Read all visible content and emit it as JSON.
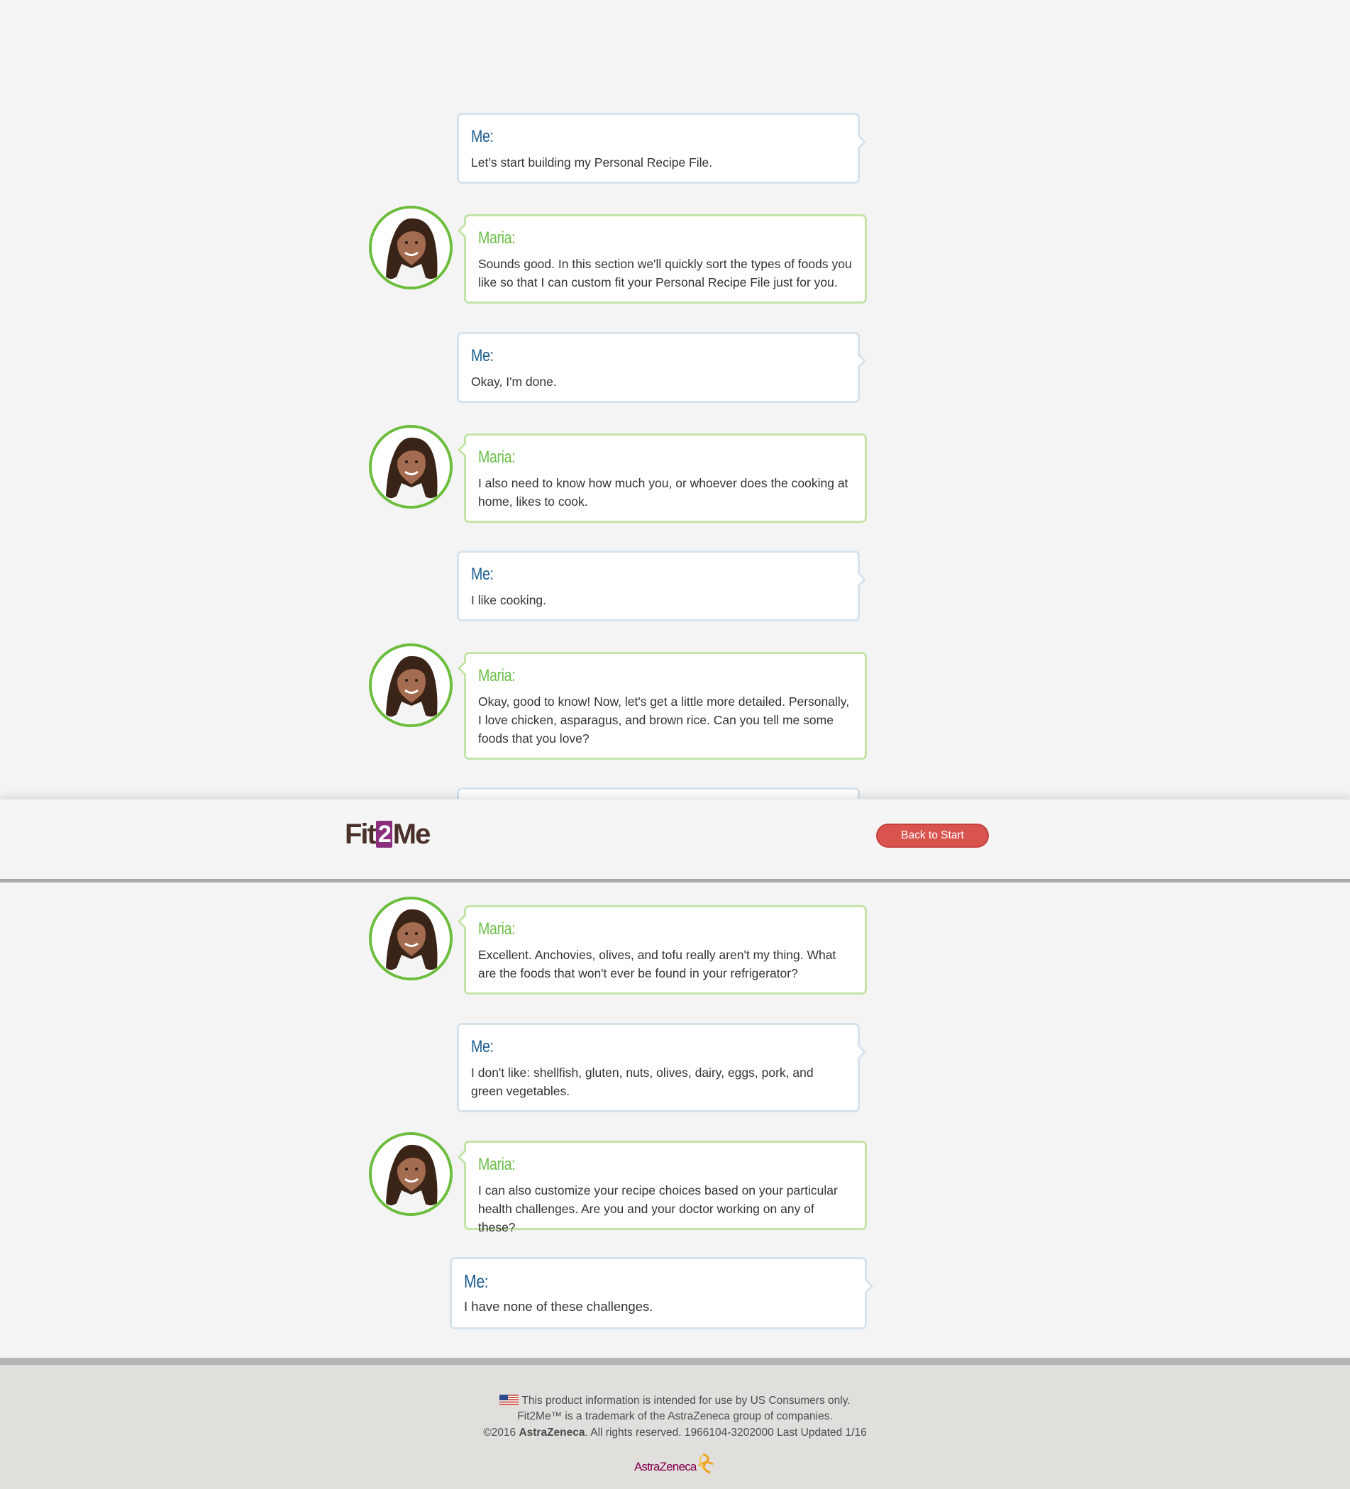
{
  "header": {
    "logo_text_a": "Fit",
    "logo_text_num": "2",
    "logo_text_b": "Me",
    "back_button_label": "Back to Start"
  },
  "conversation": {
    "me_name": "Me:",
    "maria_name": "Maria:",
    "messages": [
      {
        "speaker": "Me:",
        "text": "Let’s start building my Personal Recipe File."
      },
      {
        "speaker": "Maria:",
        "text": "Sounds good. In this section we'll quickly sort the types of foods you like so that I can custom fit your Personal Recipe File just for you."
      },
      {
        "speaker": "Me:",
        "text": "Okay, I'm done."
      },
      {
        "speaker": "Maria:",
        "text": "I also need to know how much you, or whoever does the cooking at home, likes to cook."
      },
      {
        "speaker": "Me:",
        "text": "I like cooking."
      },
      {
        "speaker": "Maria:",
        "text": "Okay, good to know! Now, let's get a little more detailed. Personally, I love chicken, asparagus, and brown rice. Can you tell me some foods that you love?"
      },
      {
        "speaker": "Maria:",
        "text": "Excellent. Anchovies, olives, and tofu really aren't my thing. What are the foods that won't ever be found in your refrigerator?"
      },
      {
        "speaker": "Me:",
        "text": "I don't like: shellfish, gluten, nuts, olives, dairy, eggs, pork, and green vegetables."
      },
      {
        "speaker": "Maria:",
        "text": "I can also customize your recipe choices based on your particular health challenges. Are you and your doctor working on any of these?"
      },
      {
        "speaker": "Me:",
        "text": "I have none of these challenges."
      }
    ]
  },
  "footer": {
    "line1": "This product information is intended for use by US Consumers only.",
    "line2": "Fit2Me™ is a trademark of the AstraZeneca group of companies.",
    "line3_pre": "©2016 ",
    "line3_brand": "AstraZeneca",
    "line3_post": ". All rights reserved. 1966104-3202000 Last Updated 1/16",
    "company_logo_text": "AstraZeneca"
  },
  "colors": {
    "me_accent": "#1b5d8f",
    "maria_accent": "#6cc04a",
    "button_red": "#d9534f",
    "logo_purple": "#8a2f7d"
  }
}
